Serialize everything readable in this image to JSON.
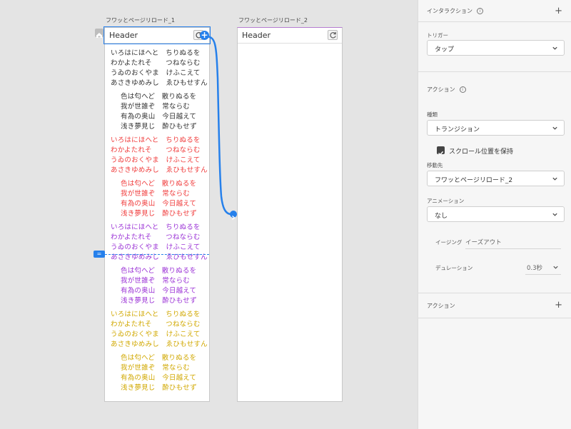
{
  "canvas": {
    "artboards": [
      {
        "title": "フワッとページリロード_1",
        "header_label": "Header",
        "blocks": [
          {
            "color": "black",
            "lines": [
              "いろはにほへと　ちりぬるを",
              "わかよたれそ　　つねならむ",
              "うゐのおくやま　けふこえて",
              "あさきゆめみし　ゑひもせすん"
            ]
          },
          {
            "color": "black",
            "lines": [
              "色は匂へど　散りぬるを",
              "我が世誰ぞ　常ならむ",
              "有為の奥山　今日越えて",
              "浅き夢見じ　酔ひもせず"
            ]
          },
          {
            "color": "red",
            "lines": [
              "いろはにほへと　ちりぬるを",
              "わかよたれそ　　つねならむ",
              "うゐのおくやま　けふこえて",
              "あさきゆめみし　ゑひもせすん"
            ]
          },
          {
            "color": "red",
            "lines": [
              "色は匂へど　散りぬるを",
              "我が世誰ぞ　常ならむ",
              "有為の奥山　今日越えて",
              "浅き夢見じ　酔ひもせず"
            ]
          },
          {
            "color": "purple",
            "lines": [
              "いろはにほへと　ちりぬるを",
              "わかよたれそ　　つねならむ",
              "うゐのおくやま　けふこえて",
              "あさきゆめみし　ゑひもせすん"
            ]
          },
          {
            "color": "purple",
            "lines": [
              "色は匂へど　散りぬるを",
              "我が世誰ぞ　常ならむ",
              "有為の奥山　今日越えて",
              "浅き夢見じ　酔ひもせず"
            ]
          },
          {
            "color": "yellow",
            "lines": [
              "いろはにほへと　ちりぬるを",
              "わかよたれそ　　つねならむ",
              "うゐのおくやま　けふこえて",
              "あさきゆめみし　ゑひもせすん"
            ]
          },
          {
            "color": "yellow",
            "lines": [
              "色は匂へど　散りぬるを",
              "我が世誰ぞ　常ならむ",
              "有為の奥山　今日越えて",
              "浅き夢見じ　酔ひもせず"
            ]
          }
        ]
      },
      {
        "title": "フワッとページリロード_2",
        "header_label": "Header"
      }
    ],
    "colors": {
      "selection": "#2680eb",
      "red": "#f03c3c",
      "purple": "#9b33d6",
      "yellow": "#d1a800"
    }
  },
  "panel": {
    "interaction_heading": "インタラクション",
    "trigger_label": "トリガー",
    "trigger_value": "タップ",
    "action_heading": "アクション",
    "type_label": "種類",
    "type_value": "トランジション",
    "preserve_scroll_label": "スクロール位置を保持",
    "preserve_scroll_checked": true,
    "destination_label": "移動先",
    "destination_value": "フワッとページリロード_2",
    "animation_label": "アニメーション",
    "animation_value": "なし",
    "easing_label": "イージング",
    "easing_value": "イーズアウト",
    "duration_label": "デュレーション",
    "duration_value": "0.3秒",
    "actions_footer_heading": "アクション"
  }
}
